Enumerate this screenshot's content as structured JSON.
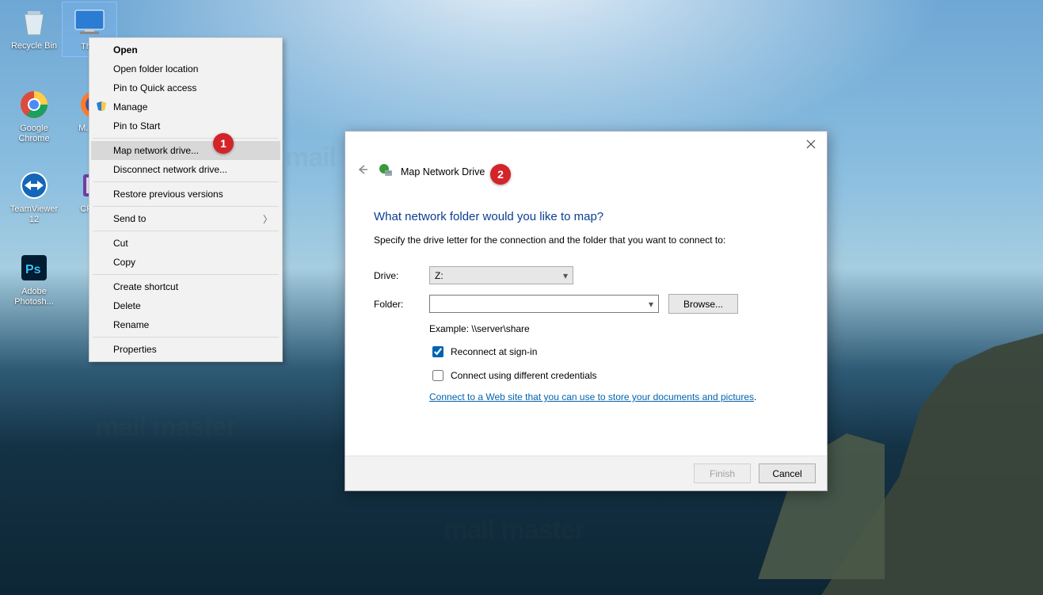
{
  "desktop_icons": [
    {
      "label": "Recycle Bin"
    },
    {
      "label": "Th..."
    },
    {
      "label": "Google Chrome"
    },
    {
      "label": "M... Fi..."
    },
    {
      "label": "TeamViewer 12"
    },
    {
      "label": "CPUI..."
    },
    {
      "label": "Adobe Photosh..."
    }
  ],
  "context_menu": {
    "items": {
      "open": "Open",
      "open_loc": "Open folder location",
      "pin_quick": "Pin to Quick access",
      "manage": "Manage",
      "pin_start": "Pin to Start",
      "map_drive": "Map network drive...",
      "disconnect": "Disconnect network drive...",
      "restore": "Restore previous versions",
      "send_to": "Send to",
      "cut": "Cut",
      "copy": "Copy",
      "create_shortcut": "Create shortcut",
      "delete": "Delete",
      "rename": "Rename",
      "properties": "Properties"
    }
  },
  "callouts": {
    "one": "1",
    "two": "2"
  },
  "dialog": {
    "title": "Map Network Drive",
    "heading": "What network folder would you like to map?",
    "description": "Specify the drive letter for the connection and the folder that you want to connect to:",
    "drive_label": "Drive:",
    "drive_value": "Z:",
    "folder_label": "Folder:",
    "folder_value": "",
    "browse": "Browse...",
    "example": "Example: \\\\server\\share",
    "reconnect": "Reconnect at sign-in",
    "reconnect_checked": true,
    "diff_cred": "Connect using different credentials",
    "diff_cred_checked": false,
    "link": "Connect to a Web site that you can use to store your documents and pictures",
    "finish": "Finish",
    "cancel": "Cancel"
  },
  "watermark": "mail master"
}
